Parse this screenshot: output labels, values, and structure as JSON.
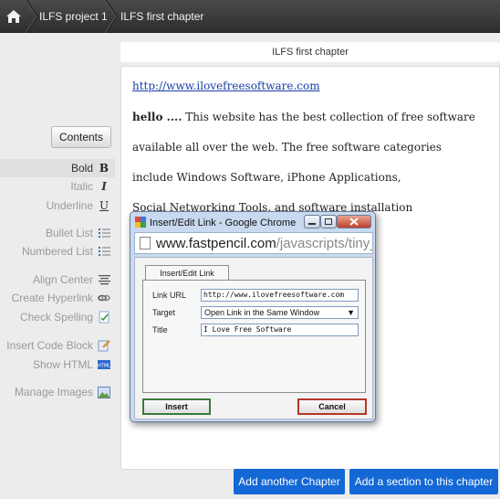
{
  "breadcrumb": {
    "items": [
      "ILFS project 1",
      "ILFS first chapter"
    ]
  },
  "sidebar": {
    "contents_label": "Contents",
    "tools": [
      {
        "label": "Bold",
        "icon": "B"
      },
      {
        "label": "Italic",
        "icon": "I"
      },
      {
        "label": "Underline",
        "icon": "U"
      },
      {
        "label": "Bullet List",
        "icon": "bullet-list-icon"
      },
      {
        "label": "Numbered List",
        "icon": "numbered-list-icon"
      },
      {
        "label": "Align Center",
        "icon": "align-center-icon"
      },
      {
        "label": "Create Hyperlink",
        "icon": "hyperlink-icon"
      },
      {
        "label": "Check Spelling",
        "icon": "spellcheck-icon"
      },
      {
        "label": "Insert Code Block",
        "icon": "code-block-icon"
      },
      {
        "label": "Show HTML",
        "icon": "html-icon"
      },
      {
        "label": "Manage Images",
        "icon": "images-icon"
      }
    ]
  },
  "editor": {
    "chapter_title": "ILFS first chapter",
    "link": "http://www.ilovefreesoftware.com",
    "bold_text": "hello ....",
    "line1_rest": " This website has the best collection of free software",
    "line2": "available all over the web. The free software categories",
    "line3": "include Windows Software, iPhone Applications,",
    "line4": "Social Networking Tools, and software installation"
  },
  "bottom_buttons": {
    "add_chapter": "Add another Chapter",
    "add_section": "Add a section to this chapter"
  },
  "popup": {
    "window_title": "Insert/Edit Link - Google Chrome",
    "url_host": "www.fastpencil.com",
    "url_path": "/javascripts/tiny_mc",
    "tab_label": "Insert/Edit Link",
    "link_url_label": "Link URL",
    "link_url_value": "http://www.ilovefreesoftware.com",
    "target_label": "Target",
    "target_value": "Open Link in the Same Window",
    "title_label": "Title",
    "title_value": "I Love Free Software",
    "insert_label": "Insert",
    "cancel_label": "Cancel"
  },
  "colors": {
    "accent_blue": "#1468d6",
    "topbar": "#3a3a3a",
    "link": "#1a3fa8"
  }
}
